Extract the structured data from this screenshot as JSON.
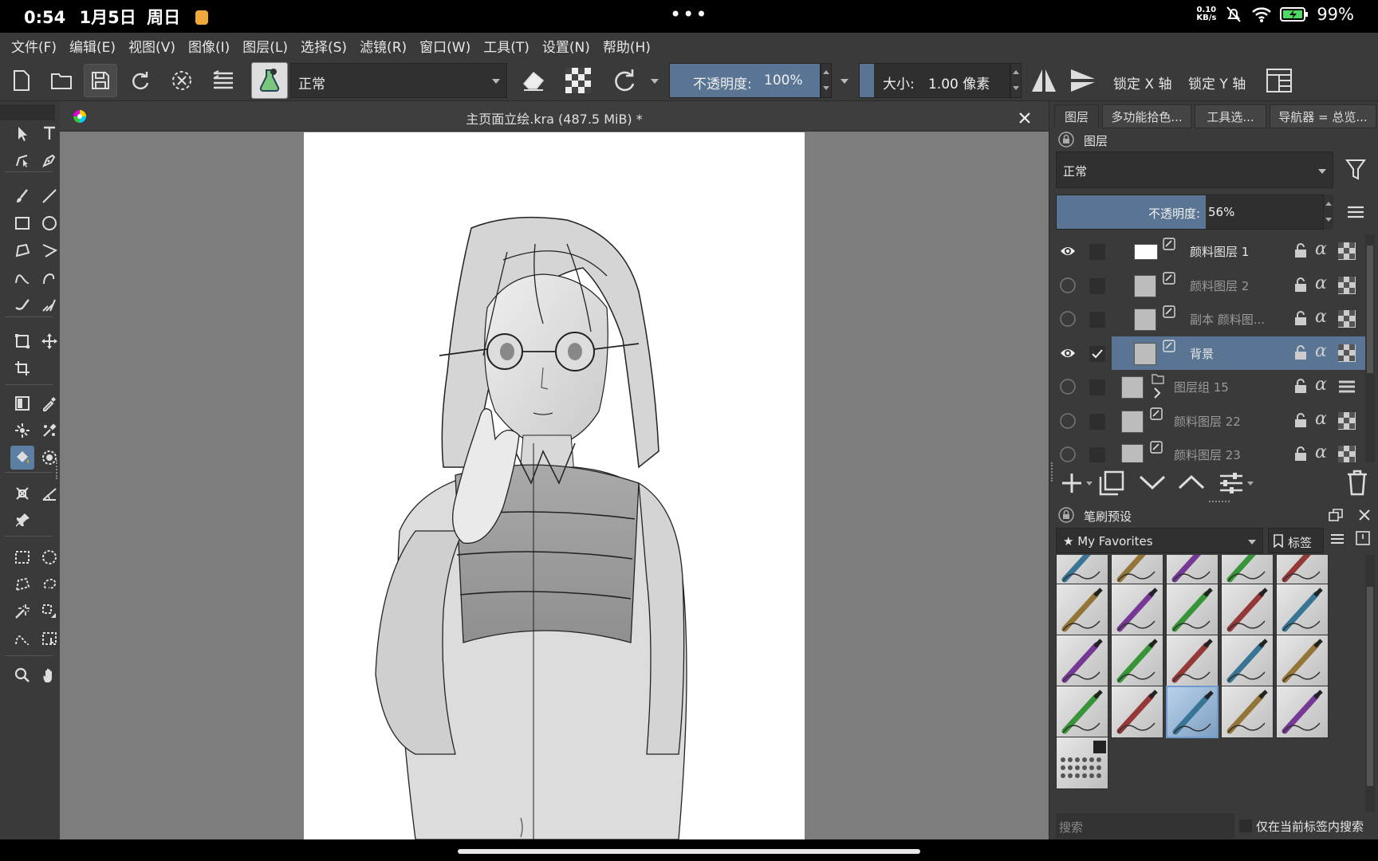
{
  "status_bar": {
    "time": "0:54",
    "date": "1月5日",
    "weekday": "周日",
    "net_speed_value": "0.10",
    "net_speed_unit": "KB/s",
    "battery": "99%",
    "center_dots": "•••"
  },
  "menu": [
    "文件(F)",
    "编辑(E)",
    "视图(V)",
    "图像(I)",
    "图层(L)",
    "选择(S)",
    "滤镜(R)",
    "窗口(W)",
    "工具(T)",
    "设置(N)",
    "帮助(H)"
  ],
  "toolbar": {
    "blend_mode": "正常",
    "opacity_label": "不透明度:",
    "opacity_value": "100%",
    "opacity_fraction": 1.0,
    "size_label": "大小:",
    "size_value": "1.00 像素",
    "lock_x": "锁定 X 轴",
    "lock_y": "锁定 Y 轴"
  },
  "document": {
    "title": "主页面立绘.kra (487.5 MiB) *"
  },
  "dock": {
    "tabs": [
      "图层",
      "多功能拾色...",
      "工具选...",
      "导航器 = 总览..."
    ],
    "layers_panel": {
      "title": "图层",
      "blend_mode": "正常",
      "opacity_label": "不透明度:",
      "opacity_value": "56%",
      "opacity_fraction": 0.56,
      "layers": [
        {
          "name": "颜料图层 1",
          "visible": true,
          "checked": false,
          "selected": false,
          "kind": "paint"
        },
        {
          "name": "颜料图层 2",
          "visible": false,
          "checked": false,
          "selected": false,
          "kind": "paint"
        },
        {
          "name": "副本 颜料图...",
          "visible": false,
          "checked": false,
          "selected": false,
          "kind": "paint"
        },
        {
          "name": "背景",
          "visible": true,
          "checked": true,
          "selected": true,
          "kind": "paint"
        },
        {
          "name": "图层组 15",
          "visible": false,
          "checked": false,
          "selected": false,
          "kind": "group"
        },
        {
          "name": "颜料图层 22",
          "visible": false,
          "checked": false,
          "selected": false,
          "kind": "paint"
        },
        {
          "name": "颜料图层 23",
          "visible": false,
          "checked": false,
          "selected": false,
          "kind": "paint"
        }
      ]
    },
    "brush_panel": {
      "title": "笔刷预设",
      "favorites": "★ My Favorites",
      "tag_button": "标签",
      "search_placeholder": "搜索",
      "search_current_tag": "仅在当前标签内搜索"
    }
  },
  "colors": {
    "accent": "#5a7594",
    "panel": "#3a3a3a",
    "canvas_bg": "#7d7d7d"
  }
}
